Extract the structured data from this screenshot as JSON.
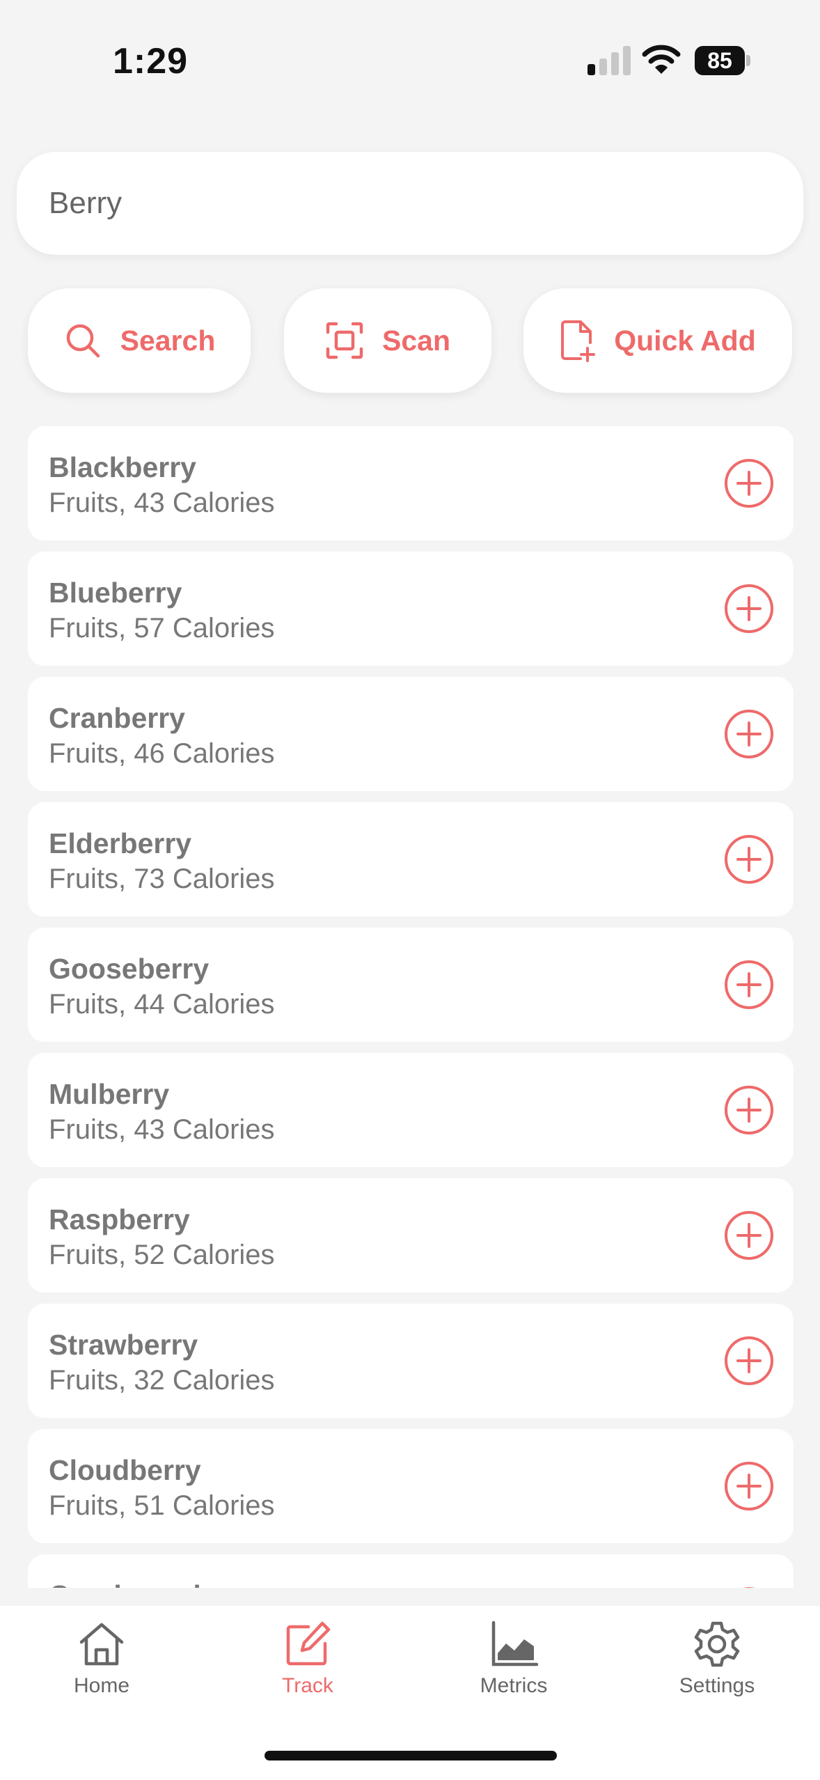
{
  "status_bar": {
    "time": "1:29",
    "battery": "85",
    "signal_bars_active": 1,
    "signal_bars_total": 4
  },
  "search": {
    "value": "Berry",
    "placeholder": ""
  },
  "actions": [
    {
      "label": "Search",
      "icon": "search-icon"
    },
    {
      "label": "Scan",
      "icon": "scan-icon"
    },
    {
      "label": "Quick Add",
      "icon": "file-add-icon"
    }
  ],
  "foods": [
    {
      "name": "Blackberry",
      "desc": "Fruits, 43 Calories"
    },
    {
      "name": "Blueberry",
      "desc": "Fruits, 57 Calories"
    },
    {
      "name": "Cranberry",
      "desc": "Fruits, 46 Calories"
    },
    {
      "name": "Elderberry",
      "desc": "Fruits, 73 Calories"
    },
    {
      "name": "Gooseberry",
      "desc": "Fruits, 44 Calories"
    },
    {
      "name": "Mulberry",
      "desc": "Fruits, 43 Calories"
    },
    {
      "name": "Raspberry",
      "desc": "Fruits, 52 Calories"
    },
    {
      "name": "Strawberry",
      "desc": "Fruits, 32 Calories"
    },
    {
      "name": "Cloudberry",
      "desc": "Fruits, 51 Calories"
    },
    {
      "name": "Cranberry beans",
      "desc": ""
    }
  ],
  "tabs": [
    {
      "label": "Home",
      "icon": "home-icon",
      "active": false
    },
    {
      "label": "Track",
      "icon": "edit-icon",
      "active": true
    },
    {
      "label": "Metrics",
      "icon": "chart-icon",
      "active": false
    },
    {
      "label": "Settings",
      "icon": "gear-icon",
      "active": false
    }
  ],
  "colors": {
    "accent": "#ee6a6a",
    "background": "#f4f4f4",
    "text_muted": "#777777"
  }
}
